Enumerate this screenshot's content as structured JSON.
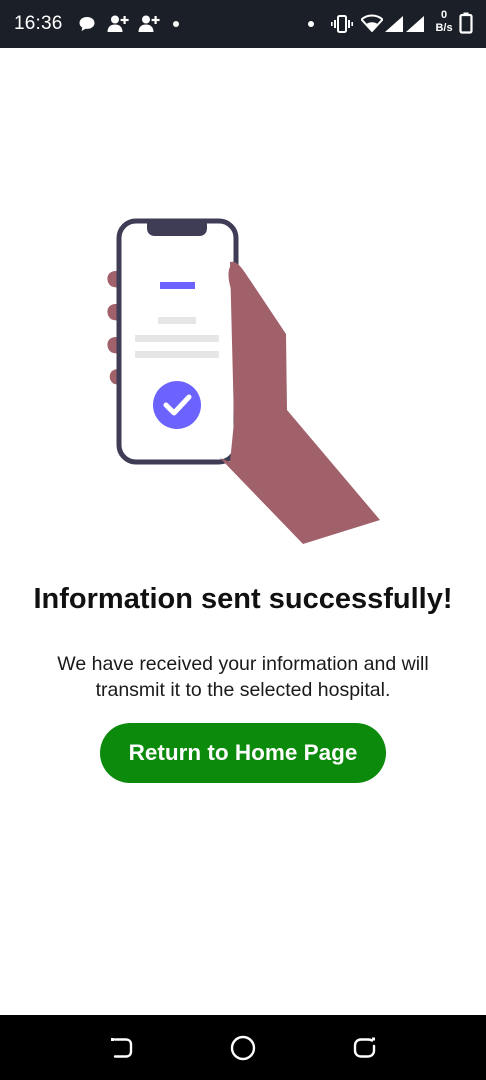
{
  "status_bar": {
    "time": "16:36",
    "net_speed_value": "0",
    "net_speed_unit": "B/s",
    "icons": [
      "chat-bubble-icon",
      "add-contact-icon",
      "add-contact-icon",
      "dot-icon",
      "dot-icon",
      "vibrate-icon",
      "wifi-icon",
      "signal-icon",
      "signal-icon",
      "battery-icon"
    ]
  },
  "illustration": {
    "description_icon": "phone-in-hand-checkmark-icon",
    "colors": {
      "accent": "#6c63ff",
      "phone_frame": "#3f3d56",
      "skin": "#a0616a",
      "placeholder_lines": "#e6e6e6"
    }
  },
  "content": {
    "title": "Information sent successfully!",
    "message": "We have received your information and will transmit it to the selected hospital.",
    "home_button_label": "Return to Home Page"
  },
  "colors": {
    "button_bg": "#0b8a0b",
    "status_bar_bg": "#1b1f27",
    "nav_bar_bg": "#000000"
  },
  "nav_bar": {
    "buttons": [
      "back-icon",
      "home-icon",
      "recents-icon"
    ]
  }
}
